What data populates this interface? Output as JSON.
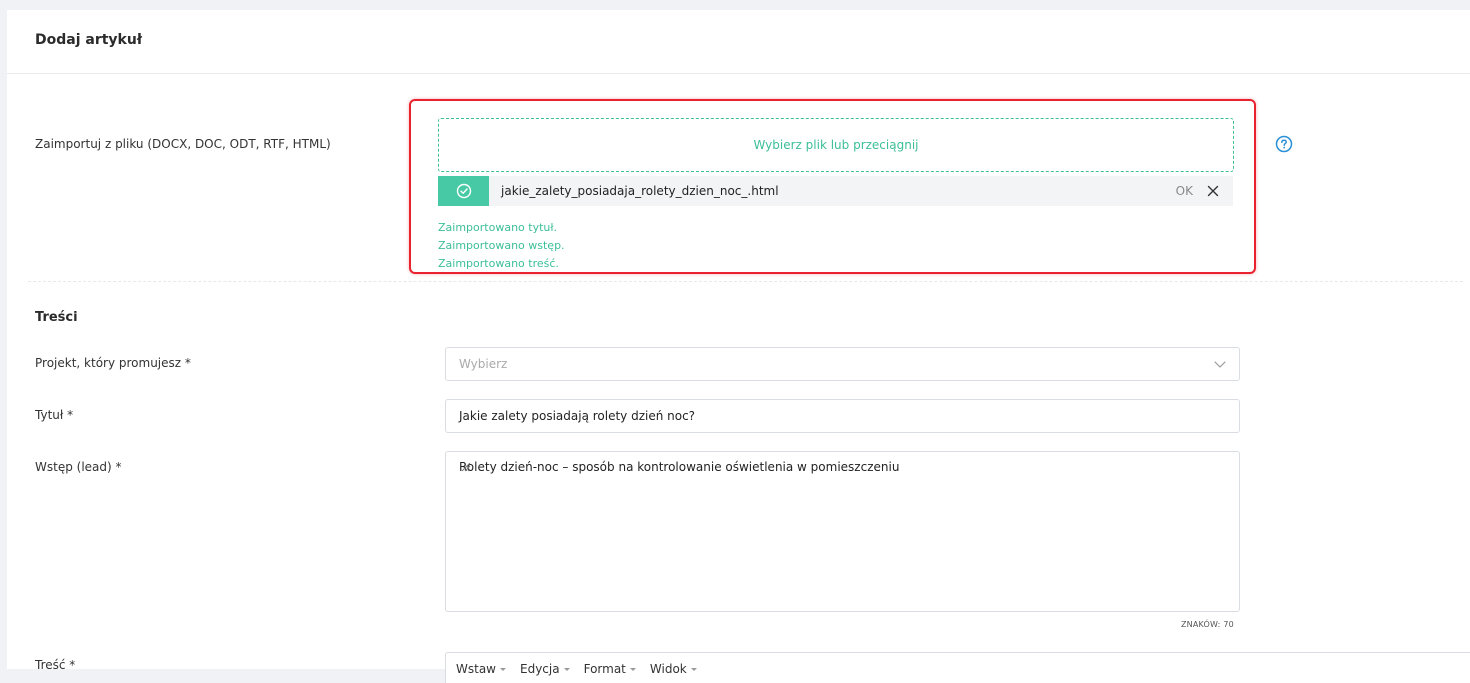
{
  "header": {
    "title": "Dodaj artykuł"
  },
  "import": {
    "label": "Zaimportuj z pliku (DOCX, DOC, ODT, RTF, HTML)",
    "dropzone_text": "Wybierz plik lub przeciągnij",
    "file_name": "jakie_zalety_posiadaja_rolety_dzien_noc_.html",
    "file_status": "OK",
    "messages": [
      "Zaimportowano tytuł.",
      "Zaimportowano wstęp.",
      "Zaimportowano treść."
    ],
    "highlight_color": "#e8232f",
    "accent_color": "#3cbf98"
  },
  "section": {
    "title": "Treści"
  },
  "project": {
    "label": "Projekt, który promujesz *",
    "placeholder": "Wybierz"
  },
  "title_field": {
    "label": "Tytuł *",
    "value": "Jakie zalety posiadają rolety dzień noc?"
  },
  "lead": {
    "label": "Wstęp (lead) *",
    "value": "Rolety dzień-noc – sposób na kontrolowanie oświetlenia w pomieszczeniu",
    "char_count": "ZNAKÓW: 70"
  },
  "content": {
    "label": "Treść *",
    "menu": [
      "Wstaw",
      "Edycja",
      "Format",
      "Widok"
    ]
  },
  "icons": {
    "help": "help-circle-icon",
    "check": "check-circle-icon",
    "close": "close-icon",
    "chevron": "chevron-down-icon",
    "resize": "resize-grip-icon"
  }
}
